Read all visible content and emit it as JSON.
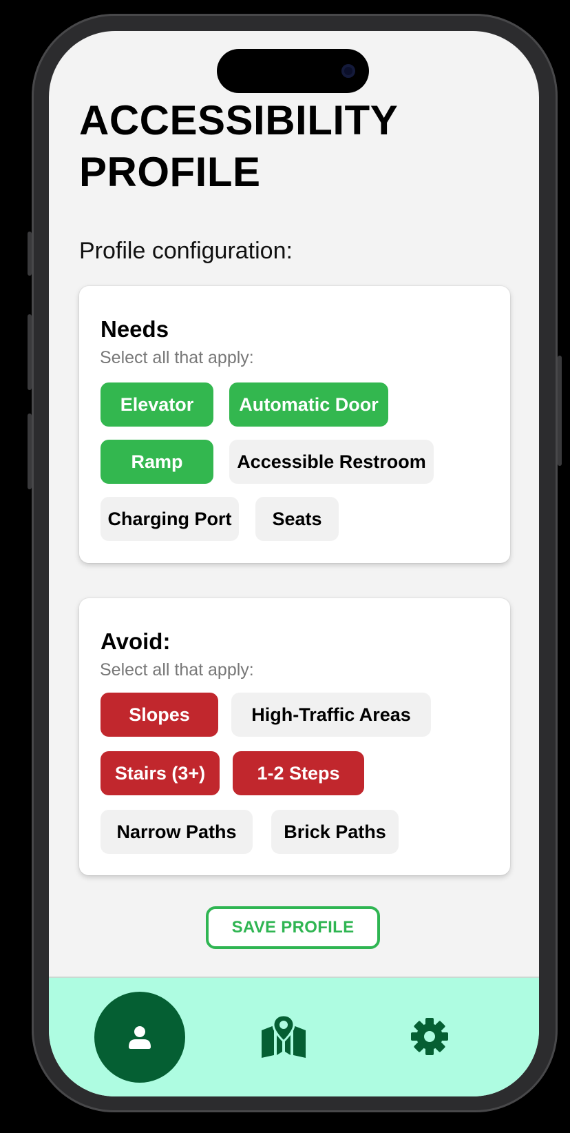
{
  "page": {
    "title": "ACCESSIBILITY PROFILE",
    "section_label": "Profile configuration:"
  },
  "needs": {
    "title": "Needs",
    "subtitle": "Select all that apply:",
    "options": [
      {
        "label": "Elevator",
        "selected": true
      },
      {
        "label": "Automatic Door",
        "selected": true
      },
      {
        "label": "Ramp",
        "selected": true
      },
      {
        "label": "Accessible Restroom",
        "selected": false
      },
      {
        "label": "Charging Port",
        "selected": false
      },
      {
        "label": "Seats",
        "selected": false
      }
    ]
  },
  "avoid": {
    "title": "Avoid:",
    "subtitle": "Select all that apply:",
    "options": [
      {
        "label": "Slopes",
        "selected": true
      },
      {
        "label": "High-Traffic Areas",
        "selected": false
      },
      {
        "label": "Stairs (3+)",
        "selected": true
      },
      {
        "label": "1-2 Steps",
        "selected": true
      },
      {
        "label": "Narrow Paths",
        "selected": false
      },
      {
        "label": "Brick Paths",
        "selected": false
      }
    ]
  },
  "save_label": "SAVE PROFILE",
  "nav": {
    "items": [
      {
        "icon": "person-icon",
        "active": true
      },
      {
        "icon": "map-icon",
        "active": false
      },
      {
        "icon": "gear-icon",
        "active": false
      }
    ]
  },
  "colors": {
    "need_selected": "#33b74f",
    "avoid_selected": "#c1272d",
    "chip_unselected": "#f1f1f1",
    "save_accent": "#2fb552",
    "nav_background": "#aefce1",
    "nav_icon": "#055f33"
  }
}
